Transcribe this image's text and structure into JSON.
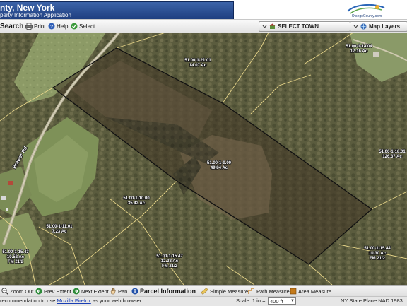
{
  "header": {
    "title": "nty, New York",
    "subtitle": "perty Information Application",
    "logo_text": "OtsegoCounty.com"
  },
  "toolbar": {
    "search": "Search",
    "print": "Print",
    "help": "Help",
    "select": "Select",
    "select_town": "SELECT TOWN",
    "map_layers": "Map Layers"
  },
  "map": {
    "road_name": "Brewer Rd",
    "parcels": [
      {
        "id": "51.00-1-21.01",
        "acreage": "14.07 Ac"
      },
      {
        "id": "51.00-1-14.04",
        "acreage": "17.16 Ac"
      },
      {
        "id": "51.00-1-9.00",
        "acreage": "49.84 Ac"
      },
      {
        "id": "51.00-1-10.00",
        "acreage": "35.42 Ac"
      },
      {
        "id": "51.00-1-11.01",
        "acreage": "7.23 Ac"
      },
      {
        "id": "51.00-1-15.43",
        "acreage": "10.52 Ac",
        "extra": "FM 21/2"
      },
      {
        "id": "51.00-1-15.47",
        "acreage": "12.33 Ac",
        "extra": "FM 21/2"
      },
      {
        "id": "51.00-1-15.44",
        "acreage": "10.30 Ac",
        "extra": "FM 21/2"
      },
      {
        "id": "51.00-1-18.01",
        "acreage": "126.37 Ac"
      }
    ]
  },
  "tools": {
    "zoom_out": "Zoom Out",
    "prev_extent": "Prev Extent",
    "next_extent": "Next Extent",
    "pan": "Pan",
    "parcel_info": "Parcel Information",
    "simple_measure": "Simple Measure",
    "path_measure": "Path Measure",
    "area_measure": "Area Measure"
  },
  "status": {
    "message_prefix": "recommendation to use",
    "firefox_link": "Mozilla Firefox",
    "message_suffix": "as your web browser.",
    "scale_label": "Scale: 1 in =",
    "scale_value": "400 ft",
    "projection": "NY State Plane NAD 1983"
  },
  "colors": {
    "banner": "#2a4f93",
    "parcel_line": "#e8d68a",
    "subject_parcel_outline": "#111111"
  }
}
